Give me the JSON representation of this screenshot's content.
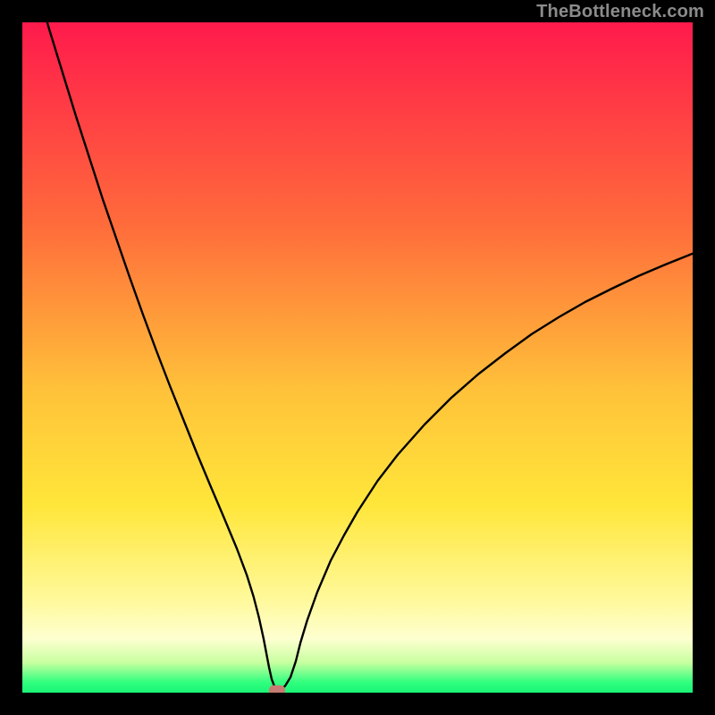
{
  "watermark": "TheBottleneck.com",
  "colors": {
    "frame": "#000000",
    "curve": "#000000",
    "marker_fill": "#c77b72",
    "gradient_stops": [
      {
        "offset": 0.0,
        "color": "#ff1a4c"
      },
      {
        "offset": 0.3,
        "color": "#ff6b3b"
      },
      {
        "offset": 0.55,
        "color": "#ffc23a"
      },
      {
        "offset": 0.72,
        "color": "#ffe63a"
      },
      {
        "offset": 0.86,
        "color": "#fff99a"
      },
      {
        "offset": 0.92,
        "color": "#fdffd0"
      },
      {
        "offset": 0.955,
        "color": "#c8ffa0"
      },
      {
        "offset": 0.985,
        "color": "#2fff7e"
      },
      {
        "offset": 1.0,
        "color": "#1bf477"
      }
    ]
  },
  "chart_data": {
    "type": "line",
    "title": "",
    "xlabel": "",
    "ylabel": "",
    "xlim": [
      0,
      100
    ],
    "ylim": [
      0,
      100
    ],
    "grid": false,
    "legend": false,
    "x": [
      0,
      2,
      4,
      6,
      8,
      10,
      12,
      14,
      16,
      18,
      20,
      22,
      24,
      26,
      28,
      30,
      32,
      33.5,
      34.5,
      35.3,
      36.0,
      36.4,
      36.8,
      37.2,
      37.7,
      38.0,
      38.3,
      38.7,
      39.2,
      40.0,
      40.8,
      41.5,
      42.5,
      44,
      46,
      48,
      50,
      53,
      56,
      60,
      64,
      68,
      72,
      76,
      80,
      84,
      88,
      92,
      96,
      100
    ],
    "values": [
      113,
      106,
      99,
      92.5,
      86,
      79.8,
      73.6,
      67.8,
      62,
      56.4,
      51,
      45.8,
      40.8,
      35.8,
      31,
      26.3,
      21.5,
      17.5,
      14.3,
      11.2,
      8.0,
      5.9,
      3.8,
      2.0,
      0.7,
      0.3,
      0.3,
      0.6,
      1.0,
      2.3,
      4.7,
      7.5,
      10.8,
      15.0,
      19.7,
      23.5,
      27.0,
      31.6,
      35.5,
      40.0,
      44.0,
      47.5,
      50.6,
      53.5,
      56.0,
      58.3,
      60.3,
      62.2,
      63.9,
      65.5
    ],
    "marker": {
      "x": 38.0,
      "y": 0.3
    },
    "annotations": []
  }
}
